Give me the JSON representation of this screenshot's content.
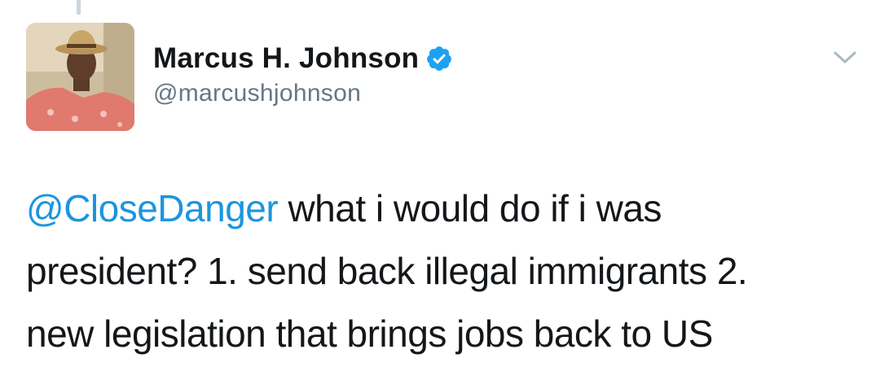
{
  "tweet": {
    "author": {
      "display_name": "Marcus H. Johnson",
      "handle": "@marcushjohnson",
      "verified": true
    },
    "mention": "@CloseDanger",
    "body_lines": [
      " what i would do if i was",
      "president? 1. send back illegal immigrants 2.",
      "new legislation that brings jobs back to US"
    ]
  },
  "icons": {
    "verified": "verified-badge-icon",
    "menu": "chevron-down-icon"
  },
  "colors": {
    "mention": "#1b95e0",
    "verified": "#1da1f2",
    "handle": "#657786",
    "text": "#14171a"
  }
}
